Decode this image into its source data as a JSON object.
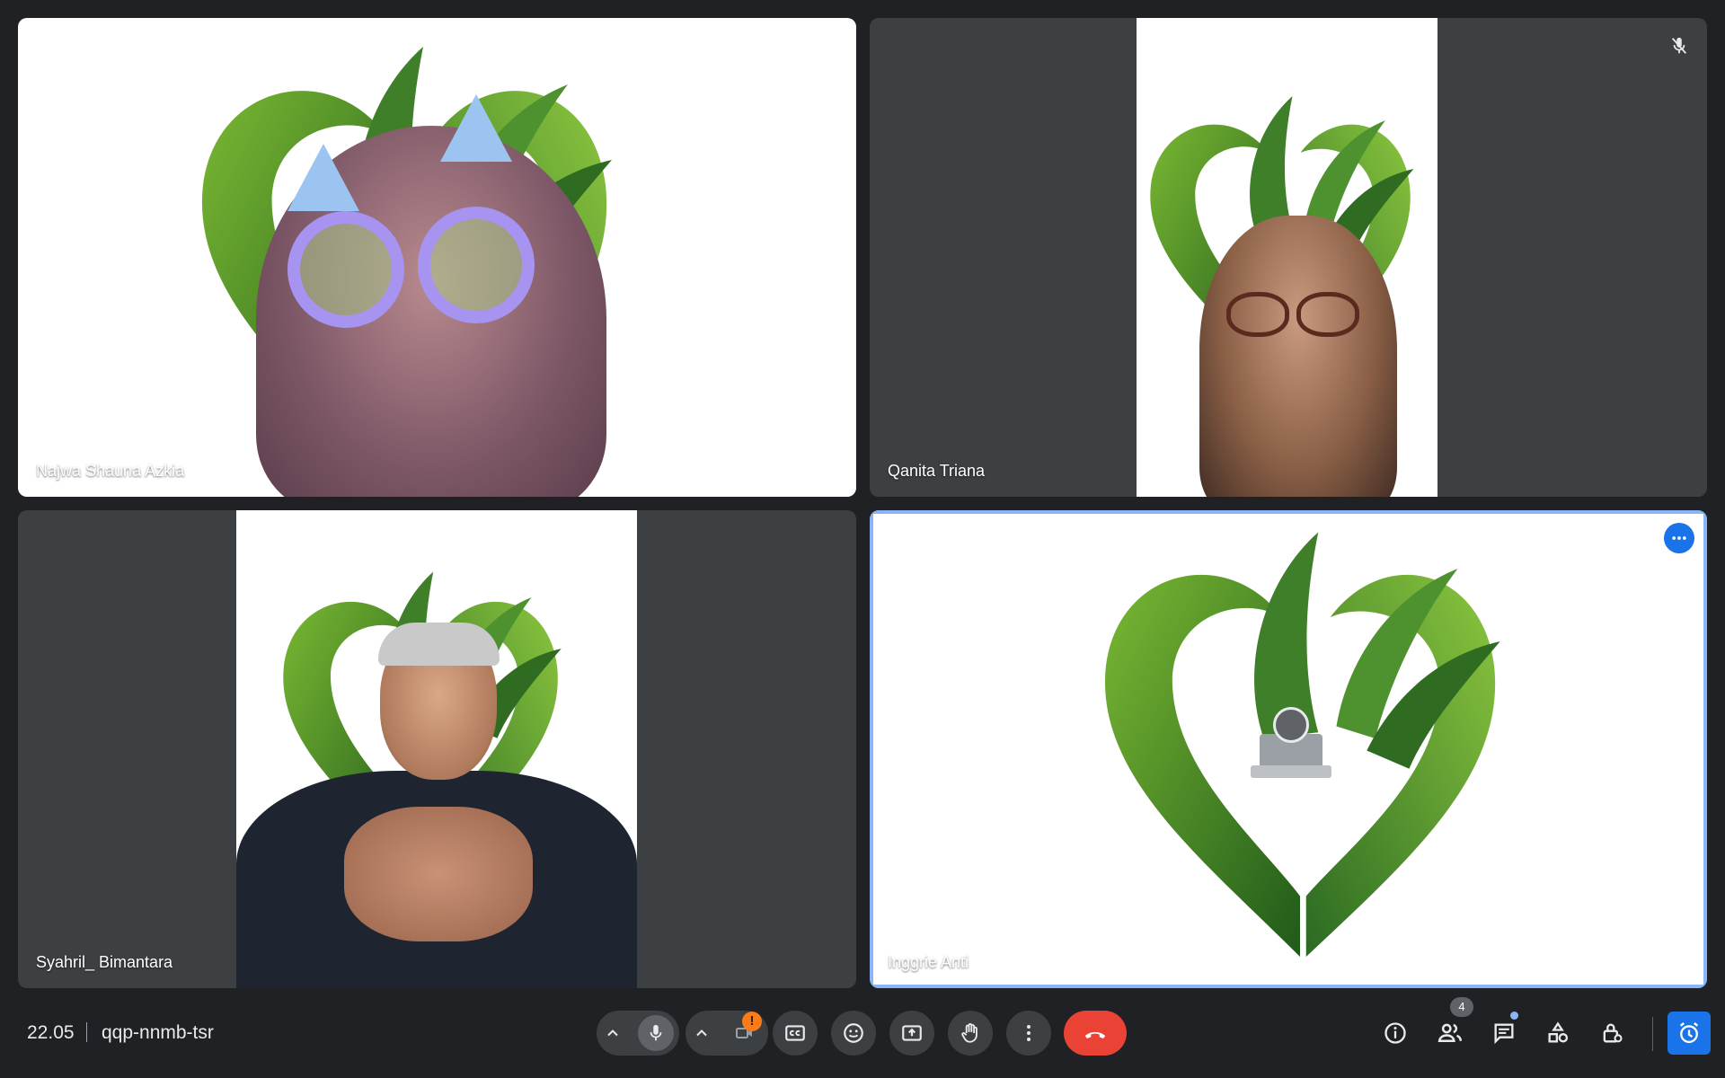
{
  "participants": [
    {
      "name": "Najwa Shauna Azkia"
    },
    {
      "name": "Qanita Triana"
    },
    {
      "name": "Syahril_ Bimantara"
    },
    {
      "name": "Inggrie Anti"
    }
  ],
  "footer": {
    "time": "22.05",
    "meeting_code": "qqp-nnmb-tsr",
    "people_count": "4",
    "camera_warning": "!"
  },
  "colors": {
    "background": "#202124",
    "tile": "#3c4043",
    "end_call": "#ea4335",
    "accent": "#8ab4f8",
    "logo_green_dark": "#2e6b1f",
    "logo_green_light": "#7ab833"
  },
  "icons": {
    "tile2": "mic-off-icon",
    "tile4": "more-options-icon",
    "controls": [
      "chevron-up-icon",
      "mic-icon",
      "chevron-up-icon",
      "camera-off-icon",
      "captions-icon",
      "emoji-icon",
      "present-screen-icon",
      "raise-hand-icon",
      "more-vert-icon",
      "end-call-icon"
    ],
    "right": [
      "info-icon",
      "people-icon",
      "chat-icon",
      "activities-icon",
      "host-controls-icon",
      "timer-icon"
    ]
  }
}
